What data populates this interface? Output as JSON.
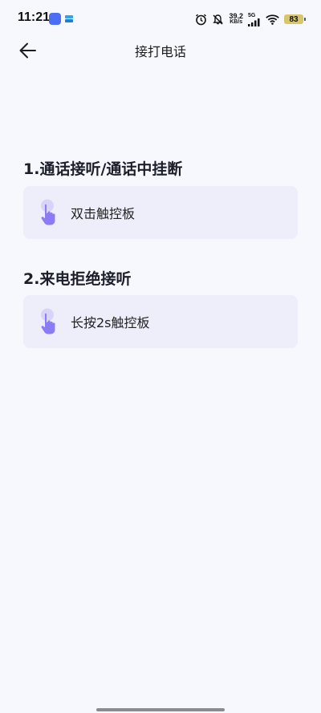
{
  "status_bar": {
    "time": "11:21",
    "net_speed_value": "39.2",
    "net_speed_unit": "KB/s",
    "network_type": "5G",
    "battery_level": "83",
    "icons": [
      "alarm-icon",
      "mute-icon",
      "signal-icon",
      "wifi-icon",
      "battery-icon"
    ]
  },
  "header": {
    "title": "接打电话",
    "back_icon": "arrow-left-icon"
  },
  "sections": [
    {
      "title": "1.通话接听/通话中挂断",
      "card_text": "双击触控板",
      "icon": "tap-hand-icon"
    },
    {
      "title": "2.来电拒绝接听",
      "card_text": "长按2s触控板",
      "icon": "tap-hand-icon"
    }
  ],
  "colors": {
    "background": "#f7f8fd",
    "card_background": "#eeeefb",
    "icon_accent": "#8b7cf6"
  }
}
